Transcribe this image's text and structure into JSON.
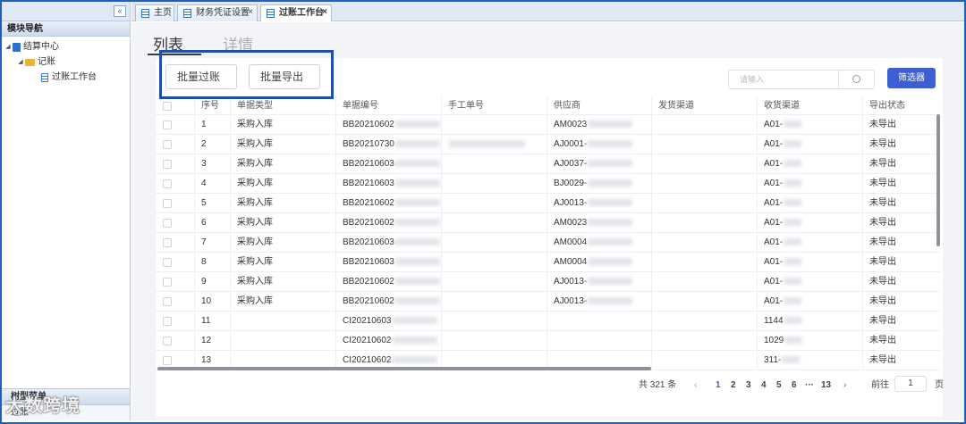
{
  "sidebar": {
    "collapse": "«",
    "title": "模块导航",
    "tree": [
      {
        "label": "结算中心",
        "level": 0,
        "icon": "book-icon"
      },
      {
        "label": "记账",
        "level": 1,
        "icon": "folder-icon"
      },
      {
        "label": "过账工作台",
        "level": 2,
        "icon": "page-icon"
      }
    ],
    "footer1": "树型菜单",
    "footer2": "过账"
  },
  "watermark": "大数跨境",
  "tabs": [
    {
      "label": "主页",
      "closable": false
    },
    {
      "label": "财务凭证设置",
      "closable": true
    },
    {
      "label": "过账工作台",
      "closable": true,
      "active": true
    }
  ],
  "close_glyph": "×",
  "subtabs": {
    "list": "列表",
    "detail": "详情"
  },
  "toolbar": {
    "batch_post": "批量过账",
    "batch_export": "批量导出",
    "search_placeholder": "请输入",
    "filter": "筛选器"
  },
  "table": {
    "headers": [
      "序号",
      "单据类型",
      "单据编号",
      "手工单号",
      "供应商",
      "发货渠道",
      "收货渠道",
      "导出状态"
    ],
    "rows": [
      {
        "no": "1",
        "type": "采购入库",
        "doc": "BB20210602",
        "manual": "",
        "supplier": "AM0023",
        "receive": "A01-",
        "status": "未导出"
      },
      {
        "no": "2",
        "type": "采购入库",
        "doc": "BB20210730",
        "manual": "blur",
        "supplier": "AJ0001-",
        "receive": "A01-",
        "status": "未导出"
      },
      {
        "no": "3",
        "type": "采购入库",
        "doc": "BB20210603",
        "manual": "",
        "supplier": "AJ0037-",
        "receive": "A01-",
        "status": "未导出"
      },
      {
        "no": "4",
        "type": "采购入库",
        "doc": "BB20210603",
        "manual": "",
        "supplier": "BJ0029-",
        "receive": "A01-",
        "status": "未导出"
      },
      {
        "no": "5",
        "type": "采购入库",
        "doc": "BB20210602",
        "manual": "",
        "supplier": "AJ0013-",
        "receive": "A01-",
        "status": "未导出"
      },
      {
        "no": "6",
        "type": "采购入库",
        "doc": "BB20210602",
        "manual": "",
        "supplier": "AM0023",
        "receive": "A01-",
        "status": "未导出"
      },
      {
        "no": "7",
        "type": "采购入库",
        "doc": "BB20210603",
        "manual": "",
        "supplier": "AM0004",
        "receive": "A01-",
        "status": "未导出"
      },
      {
        "no": "8",
        "type": "采购入库",
        "doc": "BB20210603",
        "manual": "",
        "supplier": "AM0004",
        "receive": "A01-",
        "status": "未导出"
      },
      {
        "no": "9",
        "type": "采购入库",
        "doc": "BB20210602",
        "manual": "",
        "supplier": "AJ0013-",
        "receive": "A01-",
        "status": "未导出"
      },
      {
        "no": "10",
        "type": "采购入库",
        "doc": "BB20210602",
        "manual": "",
        "supplier": "AJ0013-",
        "receive": "A01-",
        "status": "未导出"
      },
      {
        "no": "11",
        "type": "",
        "doc": "CI20210603",
        "manual": "",
        "supplier": "",
        "receive": "1144",
        "status": "未导出"
      },
      {
        "no": "12",
        "type": "",
        "doc": "CI20210602",
        "manual": "",
        "supplier": "",
        "receive": "1029",
        "status": "未导出"
      },
      {
        "no": "13",
        "type": "",
        "doc": "CI20210602",
        "manual": "",
        "supplier": "",
        "receive": "311-",
        "status": "未导出"
      }
    ]
  },
  "pagination": {
    "total": "共 321 条",
    "prev": "‹",
    "pages": [
      "1",
      "2",
      "3",
      "4",
      "5",
      "6",
      "···",
      "13"
    ],
    "current": "1",
    "next": "›",
    "goto_label": "前往",
    "goto_value": "1",
    "page_unit": "页"
  },
  "colors": {
    "accent": "#3e5fd3",
    "frame": "#1e5fbf",
    "highlight": "#1f4fae"
  }
}
